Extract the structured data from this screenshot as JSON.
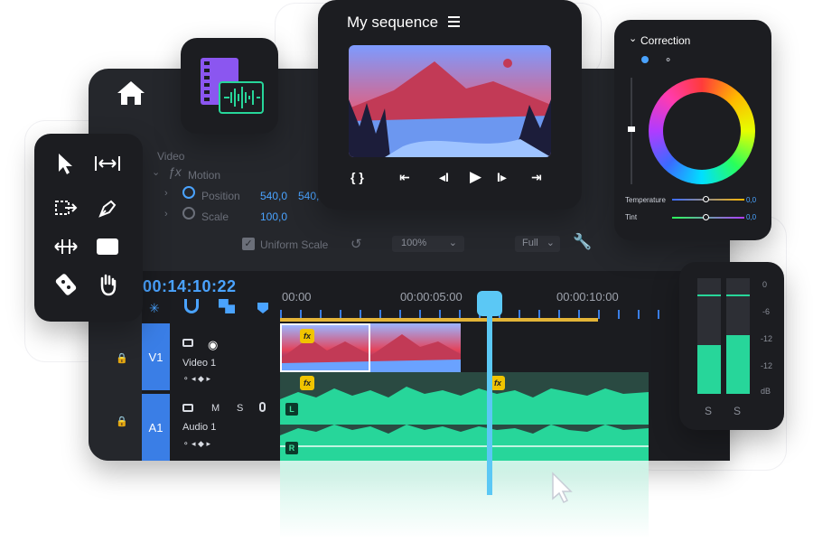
{
  "sequence": {
    "title": "My sequence"
  },
  "effects": {
    "section": "Video",
    "motion": "Motion",
    "position_label": "Position",
    "position_x": "540,0",
    "position_y": "540,",
    "scale_label": "Scale",
    "scale_value": "100,0",
    "uniform_scale": "Uniform Scale",
    "zoom": "100%",
    "quality": "Full"
  },
  "timeline": {
    "timecode": "00:14:10:22",
    "ruler": [
      "00:00",
      "00:00:05:00",
      "00:00:10:00"
    ],
    "video_track": {
      "id": "V1",
      "name": "Video 1"
    },
    "audio_track": {
      "id": "A1",
      "name": "Audio 1",
      "mute": "M",
      "solo": "S"
    },
    "channel_left": "L",
    "channel_right": "R",
    "fx_badge": "fx"
  },
  "correction": {
    "title": "Correction",
    "temperature_label": "Temperature",
    "temperature_value": "0,0",
    "tint_label": "Tint",
    "tint_value": "0,0"
  },
  "meters": {
    "scale": [
      "0",
      "-6",
      "-12",
      "-12",
      "dB"
    ],
    "solo_left": "S",
    "solo_right": "S",
    "level_left": 0.5,
    "level_right": 0.6
  },
  "colors": {
    "accent_blue": "#4aa3ff",
    "audio_green": "#27d69a",
    "playhead": "#5bc8f5",
    "work_area": "#e3b437",
    "fx_yellow": "#f0c400"
  }
}
